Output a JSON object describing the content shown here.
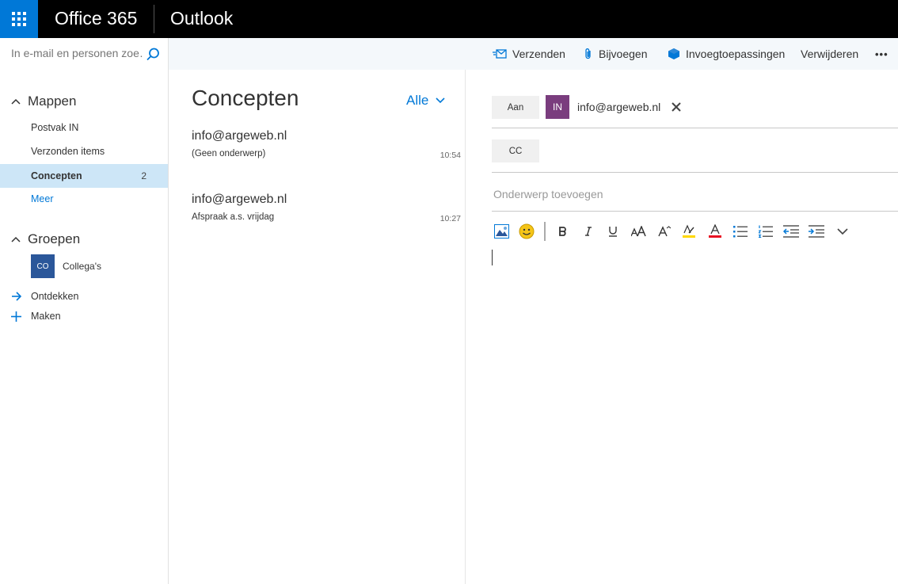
{
  "topbar": {
    "brand": "Office 365",
    "app": "Outlook"
  },
  "search": {
    "placeholder": "In e-mail en personen zoe…"
  },
  "commands": {
    "send": "Verzenden",
    "attach": "Bijvoegen",
    "addins": "Invoegtoepassingen",
    "discard": "Verwijderen",
    "more": "•••"
  },
  "folders": {
    "header": "Mappen",
    "items": [
      {
        "label": "Postvak IN",
        "count": ""
      },
      {
        "label": "Verzonden items",
        "count": ""
      },
      {
        "label": "Concepten",
        "count": "2"
      },
      {
        "label": "Meer",
        "count": ""
      }
    ]
  },
  "groups": {
    "header": "Groepen",
    "items": [
      {
        "initials": "CO",
        "label": "Collega's"
      }
    ],
    "discover": "Ontdekken",
    "create": "Maken"
  },
  "list": {
    "title": "Concepten",
    "filter": "Alle",
    "messages": [
      {
        "from": "info@argeweb.nl",
        "subject": "(Geen onderwerp)",
        "time": "10:54"
      },
      {
        "from": "info@argeweb.nl",
        "subject": "Afspraak a.s. vrijdag",
        "time": "10:27"
      }
    ]
  },
  "compose": {
    "to_label": "Aan",
    "cc_label": "CC",
    "recipient": {
      "initials": "IN",
      "email": "info@argeweb.nl"
    },
    "subject_placeholder": "Onderwerp toevoegen"
  },
  "colors": {
    "accent": "#0078d7",
    "selected": "#cde6f7",
    "recipient_avatar": "#7a3d7e",
    "group_avatar": "#2b579a"
  }
}
